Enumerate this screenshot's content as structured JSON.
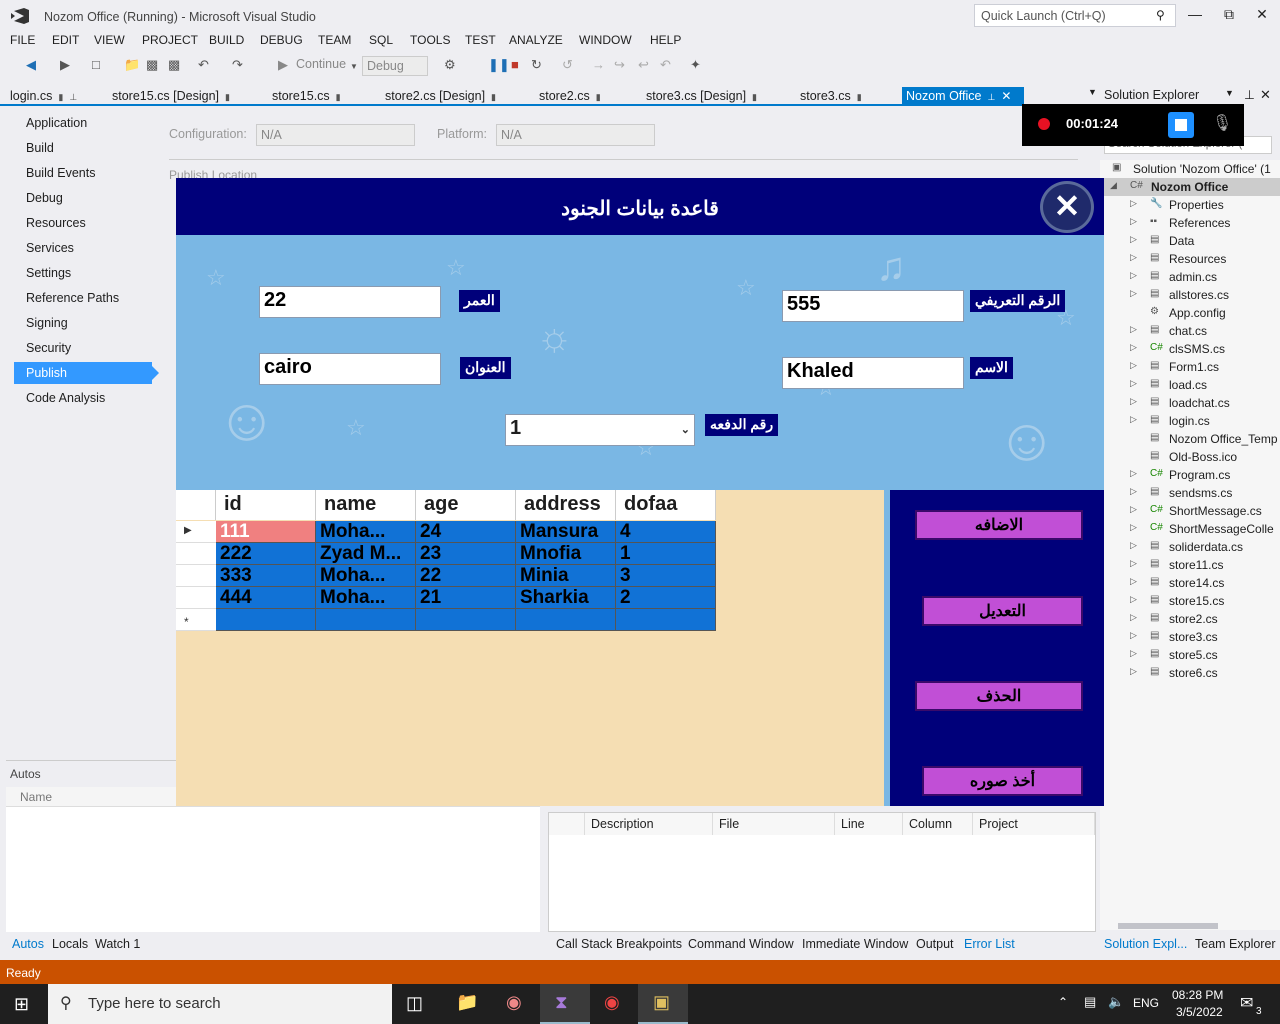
{
  "window": {
    "title": "Nozom Office (Running) - Microsoft Visual Studio",
    "quick_launch": "Quick Launch (Ctrl+Q)"
  },
  "menu": [
    "FILE",
    "EDIT",
    "VIEW",
    "PROJECT",
    "BUILD",
    "DEBUG",
    "TEAM",
    "SQL",
    "TOOLS",
    "TEST",
    "ANALYZE",
    "WINDOW",
    "HELP"
  ],
  "toolbar": {
    "continue_label": "Continue",
    "config_value": "Debug"
  },
  "doc_tabs": [
    "login.cs",
    "store15.cs [Design]",
    "store15.cs",
    "store2.cs [Design]",
    "store2.cs",
    "store3.cs [Design]",
    "store3.cs",
    "Nozom Office"
  ],
  "project_nav": [
    "Application",
    "Build",
    "Build Events",
    "Debug",
    "Resources",
    "Services",
    "Settings",
    "Reference Paths",
    "Signing",
    "Security",
    "Publish",
    "Code Analysis"
  ],
  "config_bar": {
    "configuration_label": "Configuration:",
    "configuration_value": "N/A",
    "platform_label": "Platform:",
    "platform_value": "N/A",
    "publish_location": "Publish Location"
  },
  "autos": {
    "title": "Autos",
    "name_col": "Name"
  },
  "bottom_tabs_left": [
    "Autos",
    "Locals",
    "Watch 1"
  ],
  "error_list_cols": [
    "Description",
    "File",
    "Line",
    "Column",
    "Project"
  ],
  "bottom_tabs_mid": [
    "Call Stack",
    "Breakpoints",
    "Command Window",
    "Immediate Window",
    "Output",
    "Error List"
  ],
  "solution_explorer": {
    "title": "Solution Explorer",
    "search_placeholder": "Search Solution Explorer (",
    "items": [
      "Solution 'Nozom Office' (1",
      "Nozom Office",
      "Properties",
      "References",
      "Data",
      "Resources",
      "admin.cs",
      "allstores.cs",
      "App.config",
      "chat.cs",
      "clsSMS.cs",
      "Form1.cs",
      "load.cs",
      "loadchat.cs",
      "login.cs",
      "Nozom Office_Temp",
      "Old-Boss.ico",
      "Program.cs",
      "sendsms.cs",
      "ShortMessage.cs",
      "ShortMessageColle",
      "soliderdata.cs",
      "store11.cs",
      "store14.cs",
      "store15.cs",
      "store2.cs",
      "store3.cs",
      "store5.cs",
      "store6.cs"
    ],
    "bottom_tabs": [
      "Solution Expl...",
      "Team Explorer"
    ]
  },
  "recorder": {
    "time": "00:01:24"
  },
  "status": "Ready",
  "taskbar": {
    "search_placeholder": "Type here to search",
    "lang": "ENG",
    "time": "08:28 PM",
    "date": "3/5/2022",
    "badge": "3"
  },
  "app": {
    "title": "قاعدة بيانات الجنود",
    "fields": {
      "age_label": "العمر",
      "age_value": "22",
      "id_label": "الرقم التعريفي",
      "id_value": "555",
      "address_label": "العنوان",
      "address_value": "cairo",
      "name_label": "الاسم",
      "name_value": "Khaled",
      "batch_label": "رقم الدفعه",
      "batch_value": "1"
    },
    "grid": {
      "headers": [
        "id",
        "name",
        "age",
        "address",
        "dofaa"
      ],
      "rows": [
        [
          "111",
          "Moha...",
          "24",
          "Mansura",
          "4"
        ],
        [
          "222",
          "Zyad M...",
          "23",
          "Mnofia",
          "1"
        ],
        [
          "333",
          "Moha...",
          "22",
          "Minia",
          "3"
        ],
        [
          "444",
          "Moha...",
          "21",
          "Sharkia",
          "2"
        ]
      ],
      "new_row_marker": "*"
    },
    "buttons": {
      "add": "الاضافه",
      "edit": "التعديل",
      "delete": "الحذف",
      "photo": "أخذ صوره"
    }
  }
}
